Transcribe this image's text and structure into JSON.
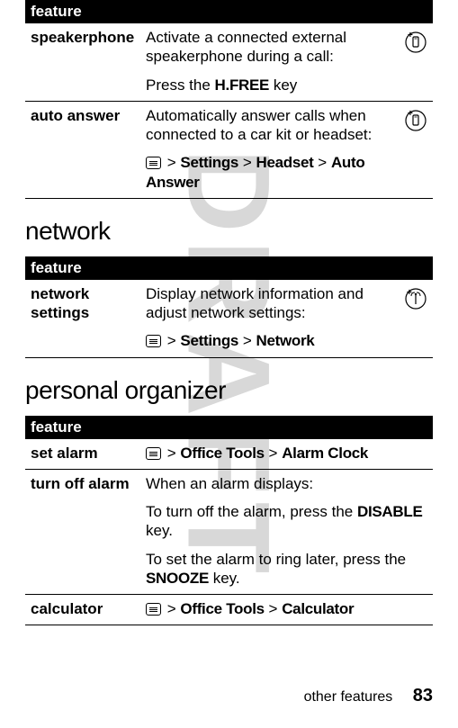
{
  "watermark": "DRAFT",
  "tables": {
    "t1": {
      "header": "feature",
      "rows": [
        {
          "name": "speakerphone",
          "desc1": "Activate a connected external speakerphone during a call:",
          "desc2a": "Press the ",
          "desc2b": "H.FREE",
          "desc2c": " key",
          "icon": "phone"
        },
        {
          "name": "auto answer",
          "desc1": "Automatically answer calls when connected to a car kit or headset:",
          "path1": "Settings",
          "path2": "Headset",
          "path3": "Auto Answer",
          "icon": "phone"
        }
      ]
    },
    "t2": {
      "heading": "network",
      "header": "feature",
      "rows": [
        {
          "name": "network settings",
          "desc1": "Display network information and adjust network settings:",
          "path1": "Settings",
          "path2": "Network",
          "icon": "antenna"
        }
      ]
    },
    "t3": {
      "heading": "personal organizer",
      "header": "feature",
      "rows": [
        {
          "name": "set alarm",
          "path1": "Office Tools",
          "path2": "Alarm Clock"
        },
        {
          "name": "turn off alarm",
          "desc1": "When an alarm displays:",
          "desc2a": "To turn off the alarm, press the ",
          "desc2b": "DISABLE",
          "desc2c": " key.",
          "desc3a": "To set the alarm to ring later, press the ",
          "desc3b": "SNOOZE",
          "desc3c": " key."
        },
        {
          "name": "calculator",
          "path1": "Office Tools",
          "path2": "Calculator"
        }
      ]
    }
  },
  "footer": {
    "text": "other features",
    "page": "83"
  },
  "sym": {
    "gt": ">"
  }
}
